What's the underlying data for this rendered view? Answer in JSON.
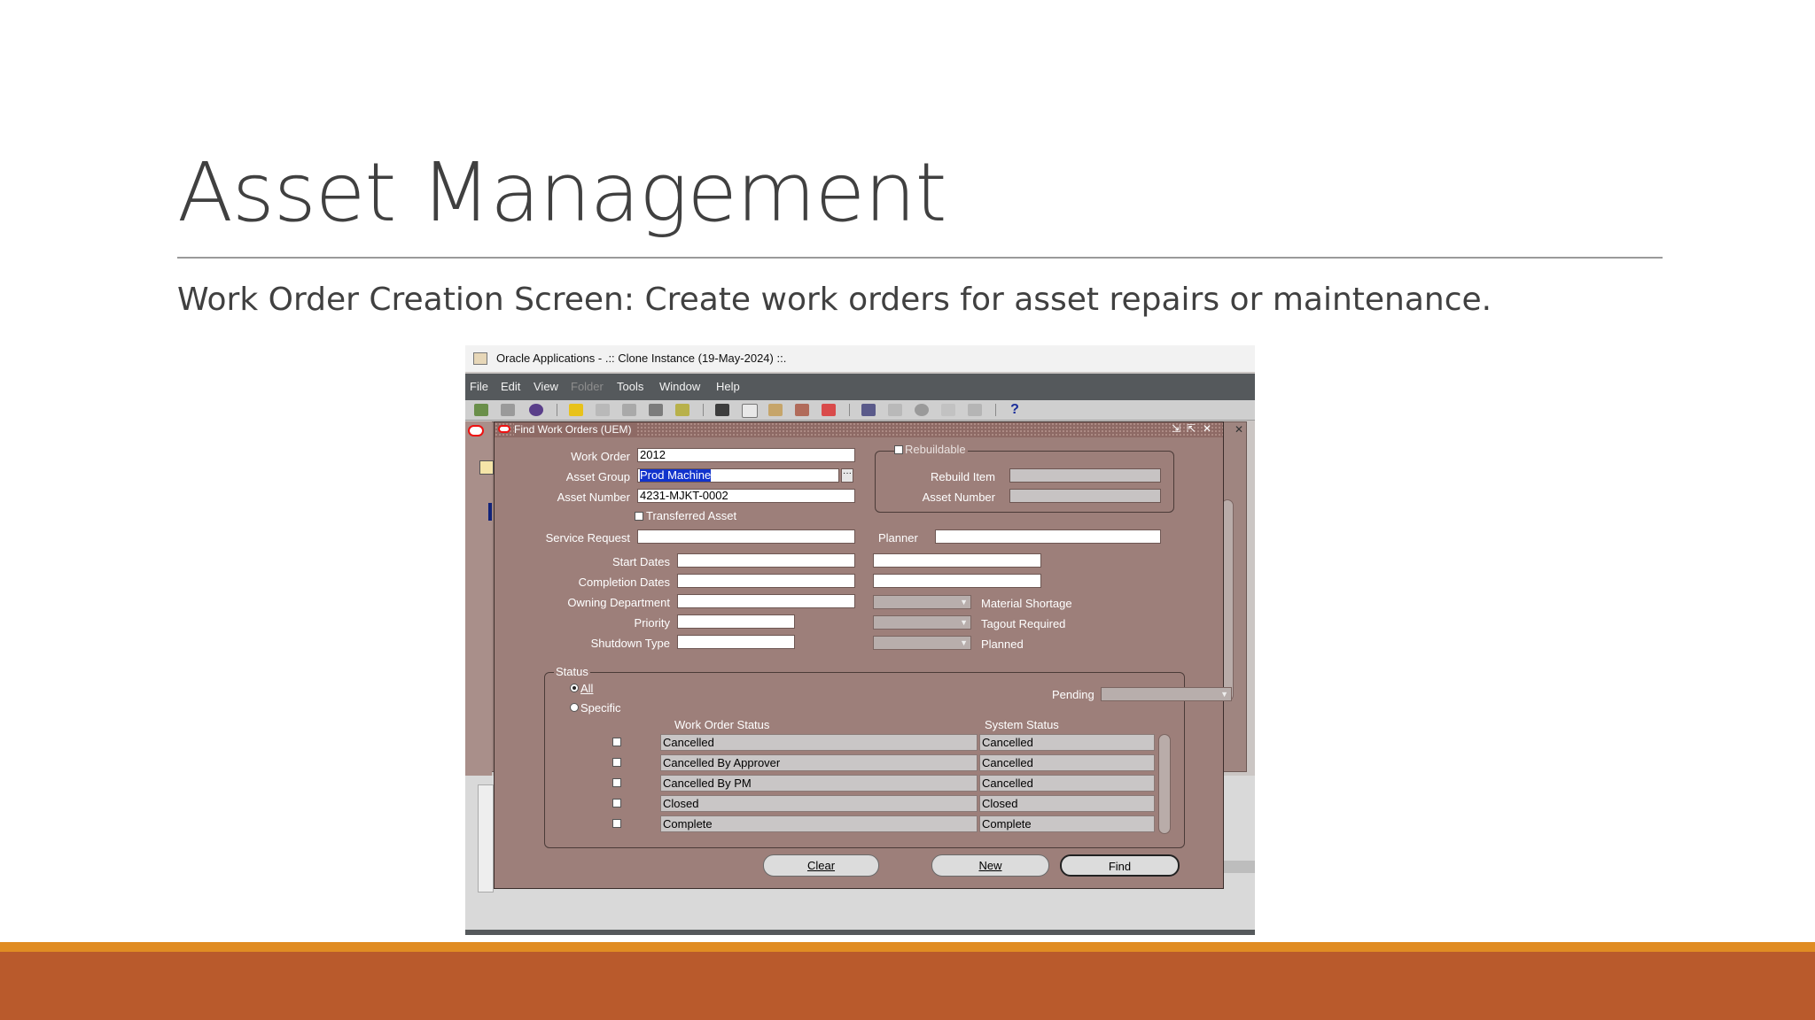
{
  "slide": {
    "title": "Asset Management",
    "subtitle": "Work Order Creation Screen: Create work orders for asset repairs or maintenance.",
    "colors": {
      "band_orange": "#e08c23",
      "band_rust": "#b95a2c"
    }
  },
  "app": {
    "window_title": "Oracle Applications - .:: Clone Instance (19-May-2024) ::.",
    "menu": [
      "File",
      "Edit",
      "View",
      "Folder",
      "Tools",
      "Window",
      "Help"
    ],
    "dialog": {
      "title": "Find Work Orders (UEM)",
      "work_order_label": "Work Order",
      "work_order_value": "2012",
      "asset_group_label": "Asset Group",
      "asset_group_value": "Prod Machine",
      "asset_number_label": "Asset Number",
      "asset_number_value": "4231-MJKT-0002",
      "transferred_asset_label": "Transferred Asset",
      "rebuildable_label": "Rebuildable",
      "rebuild_item_label": "Rebuild Item",
      "rebuild_asset_number_label": "Asset Number",
      "service_request_label": "Service Request",
      "planner_label": "Planner",
      "start_dates_label": "Start Dates",
      "completion_dates_label": "Completion Dates",
      "owning_department_label": "Owning Department",
      "priority_label": "Priority",
      "shutdown_type_label": "Shutdown Type",
      "material_shortage_label": "Material Shortage",
      "tagout_required_label": "Tagout Required",
      "planned_label": "Planned",
      "status": {
        "group_label": "Status",
        "all_label": "All",
        "specific_label": "Specific",
        "pending_label": "Pending",
        "col_work_order_status": "Work Order Status",
        "col_system_status": "System Status",
        "rows": [
          {
            "work_order_status": "Cancelled",
            "system_status": "Cancelled"
          },
          {
            "work_order_status": "Cancelled By Approver",
            "system_status": "Cancelled"
          },
          {
            "work_order_status": "Cancelled By PM",
            "system_status": "Cancelled"
          },
          {
            "work_order_status": "Closed",
            "system_status": "Closed"
          },
          {
            "work_order_status": "Complete",
            "system_status": "Complete"
          }
        ]
      },
      "buttons": {
        "clear": "Clear",
        "new": "New",
        "find": "Find"
      }
    }
  }
}
